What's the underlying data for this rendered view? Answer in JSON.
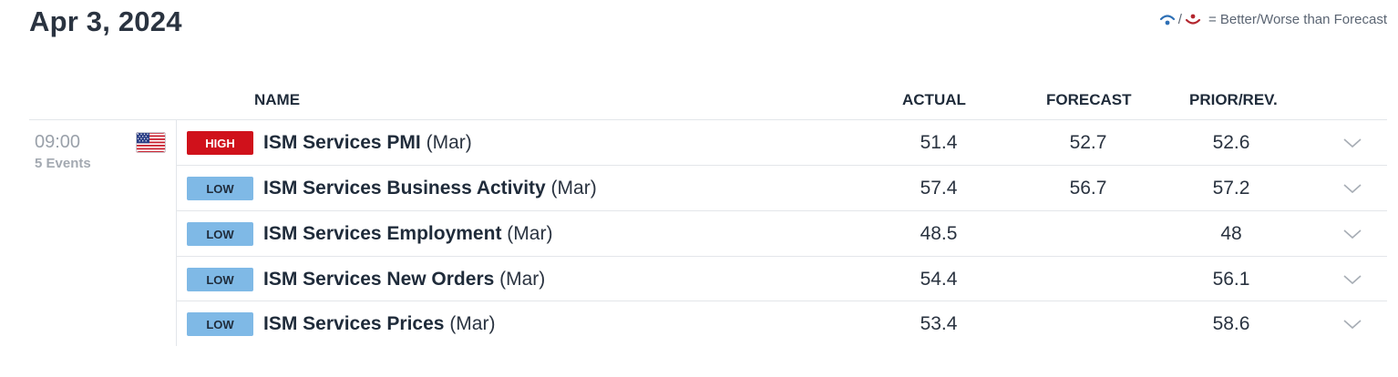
{
  "header": {
    "date": "Apr 3, 2024",
    "legend_text": "= Better/Worse than Forecast",
    "legend_slash": "/",
    "better_icon": "better-than-forecast-icon",
    "worse_icon": "worse-than-forecast-icon"
  },
  "columns": {
    "name": "NAME",
    "actual": "ACTUAL",
    "forecast": "FORECAST",
    "prior": "PRIOR/REV."
  },
  "group": {
    "time": "09:00",
    "events": "5 Events",
    "flag": "us-flag-icon"
  },
  "colors": {
    "high": "#d0111b",
    "low": "#7fb9e6",
    "better": "#2d6fb5",
    "worse": "#b3262e"
  },
  "rows": [
    {
      "impact": "HIGH",
      "name": "ISM Services PMI",
      "period": "(Mar)",
      "actual": "51.4",
      "forecast": "52.7",
      "prior": "52.6"
    },
    {
      "impact": "LOW",
      "name": "ISM Services Business Activity",
      "period": "(Mar)",
      "actual": "57.4",
      "forecast": "56.7",
      "prior": "57.2"
    },
    {
      "impact": "LOW",
      "name": "ISM Services Employment",
      "period": "(Mar)",
      "actual": "48.5",
      "forecast": "",
      "prior": "48"
    },
    {
      "impact": "LOW",
      "name": "ISM Services New Orders",
      "period": "(Mar)",
      "actual": "54.4",
      "forecast": "",
      "prior": "56.1"
    },
    {
      "impact": "LOW",
      "name": "ISM Services Prices",
      "period": "(Mar)",
      "actual": "53.4",
      "forecast": "",
      "prior": "58.6"
    }
  ]
}
